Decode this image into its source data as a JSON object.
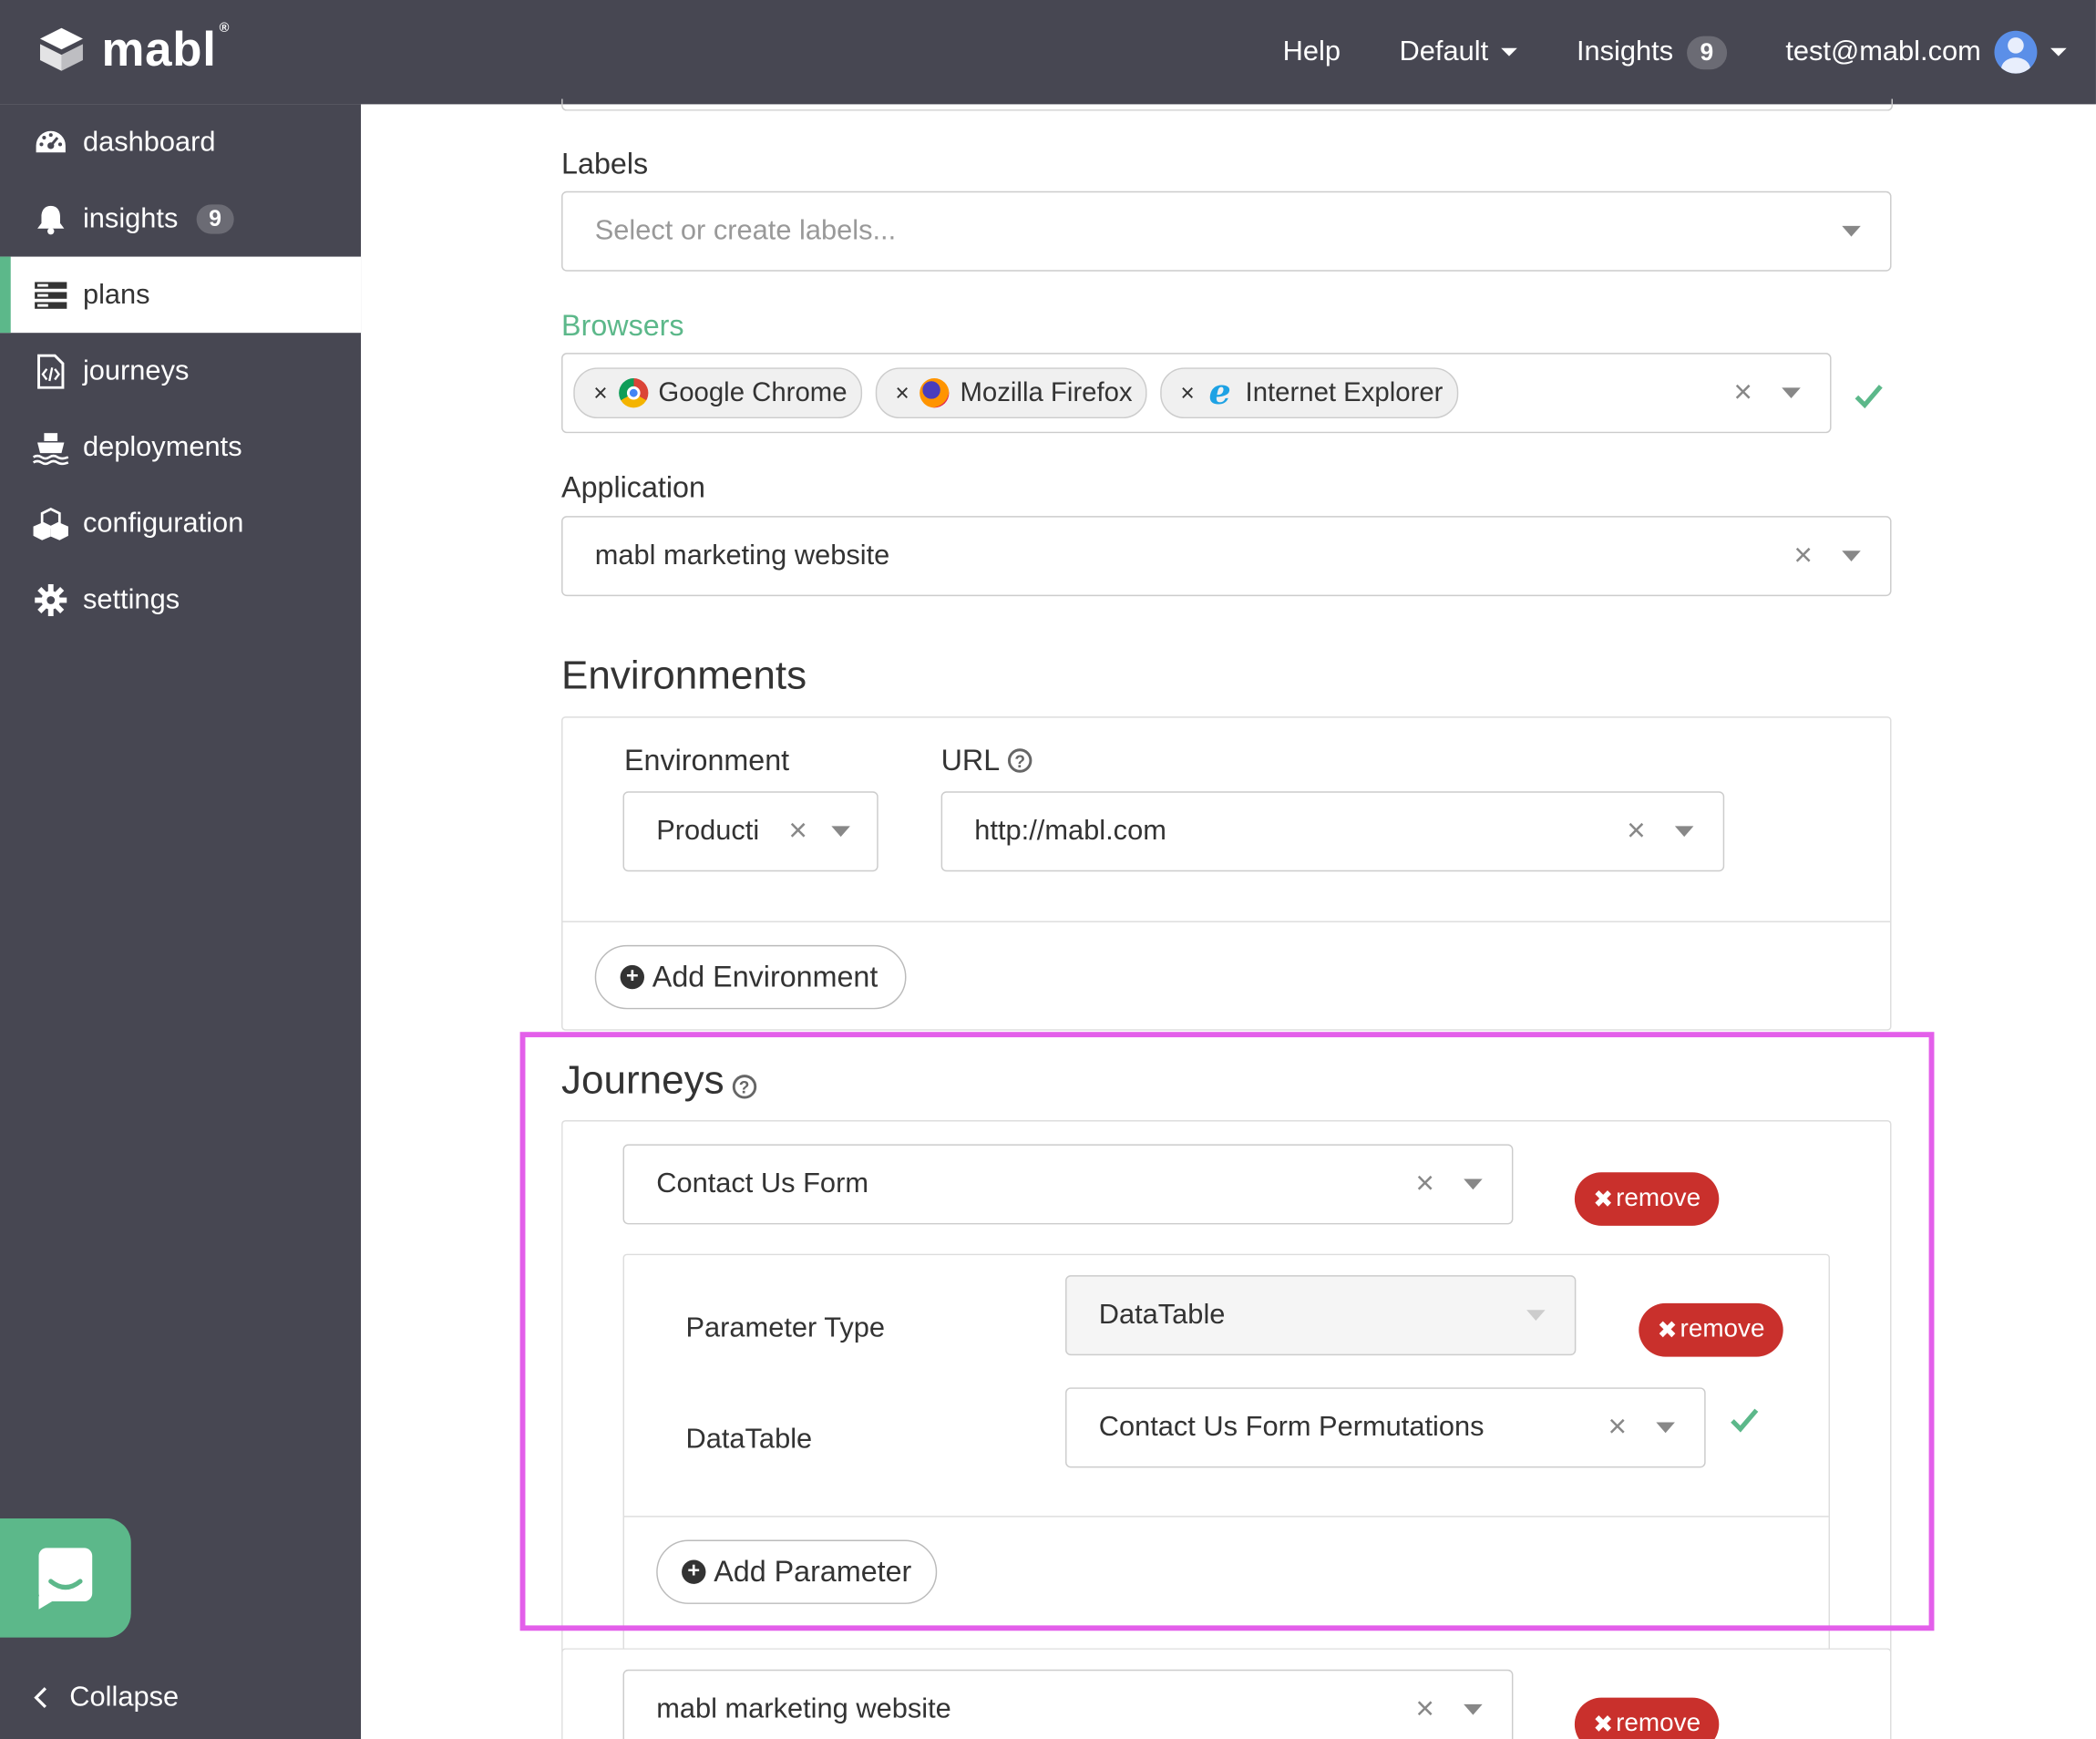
{
  "brand": {
    "name": "mabl",
    "mark": "®"
  },
  "topnav": {
    "help": "Help",
    "workspace": "Default",
    "insights": "Insights",
    "insights_count": "9",
    "user_email": "test@mabl.com"
  },
  "sidebar": {
    "items": [
      {
        "label": "dashboard",
        "icon": "dashboard-icon"
      },
      {
        "label": "insights",
        "icon": "bell-icon",
        "badge": "9"
      },
      {
        "label": "plans",
        "icon": "plans-icon"
      },
      {
        "label": "journeys",
        "icon": "journey-file-icon"
      },
      {
        "label": "deployments",
        "icon": "ship-icon"
      },
      {
        "label": "configuration",
        "icon": "cubes-icon"
      },
      {
        "label": "settings",
        "icon": "gear-icon"
      }
    ],
    "collapse": "Collapse"
  },
  "form": {
    "labels_title": "Labels",
    "labels_placeholder": "Select or create labels...",
    "browsers_title": "Browsers",
    "browsers": [
      "Google Chrome",
      "Mozilla Firefox",
      "Internet Explorer"
    ],
    "application_title": "Application",
    "application_value": "mabl marketing website",
    "environments_title": "Environments",
    "environment_label": "Environment",
    "environment_value": "Producti",
    "url_label": "URL",
    "url_value": "http://mabl.com",
    "add_environment": "Add Environment",
    "journeys_title": "Journeys",
    "journey1_value": "Contact Us Form",
    "remove_label": "remove",
    "param_type_label": "Parameter Type",
    "param_type_value": "DataTable",
    "datatable_label": "DataTable",
    "datatable_value": "Contact Us Form Permutations",
    "add_parameter": "Add Parameter",
    "journey2_value": "mabl marketing website"
  },
  "colors": {
    "nav_bg": "#474752",
    "accent_green": "#5cb88a",
    "danger": "#c9302c",
    "highlight": "#e35fea"
  }
}
